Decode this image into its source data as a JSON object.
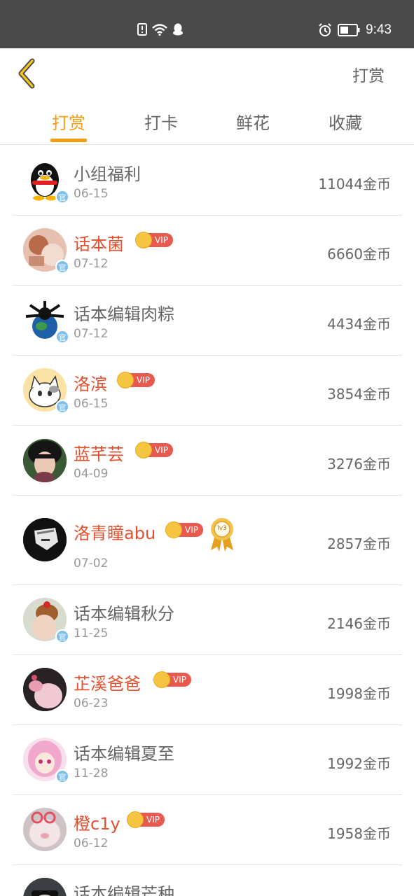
{
  "status_bar": {
    "time": "9:43"
  },
  "header": {
    "action_label": "打赏"
  },
  "tabs": [
    {
      "label": "打赏",
      "active": true
    },
    {
      "label": "打卡",
      "active": false
    },
    {
      "label": "鲜花",
      "active": false
    },
    {
      "label": "收藏",
      "active": false
    }
  ],
  "vip_label": "VIP",
  "official_badge": "官",
  "medal_label": "lv3",
  "rows": [
    {
      "name": "小组福利",
      "date": "06-15",
      "coins": "11044金币",
      "vip": false,
      "official": true
    },
    {
      "name": "话本菌",
      "date": "07-12",
      "coins": "6660金币",
      "vip": true,
      "official": true
    },
    {
      "name": "话本编辑肉粽",
      "date": "07-12",
      "coins": "4434金币",
      "vip": false,
      "official": true
    },
    {
      "name": "洛滨",
      "date": "06-15",
      "coins": "3854金币",
      "vip": true,
      "official": true
    },
    {
      "name": "蓝芊芸",
      "date": "04-09",
      "coins": "3276金币",
      "vip": true,
      "official": false
    },
    {
      "name": "洛青瞳abu",
      "date": "07-02",
      "coins": "2857金币",
      "vip": true,
      "official": false,
      "medal": true
    },
    {
      "name": "话本编辑秋分",
      "date": "11-25",
      "coins": "2146金币",
      "vip": false,
      "official": true
    },
    {
      "name": "芷溪爸爸",
      "date": "06-23",
      "coins": "1998金币",
      "vip": true,
      "official": false
    },
    {
      "name": "话本编辑夏至",
      "date": "11-28",
      "coins": "1992金币",
      "vip": false,
      "official": true
    },
    {
      "name": "橙c1y",
      "date": "06-12",
      "coins": "1958金币",
      "vip": true,
      "official": false
    },
    {
      "name": "话本编辑芒种",
      "date": "",
      "coins": "",
      "vip": false,
      "official": true
    }
  ],
  "colors": {
    "accent": "#f39c12",
    "vip_name": "#e4502f",
    "status_bar": "#4a4a4a"
  }
}
